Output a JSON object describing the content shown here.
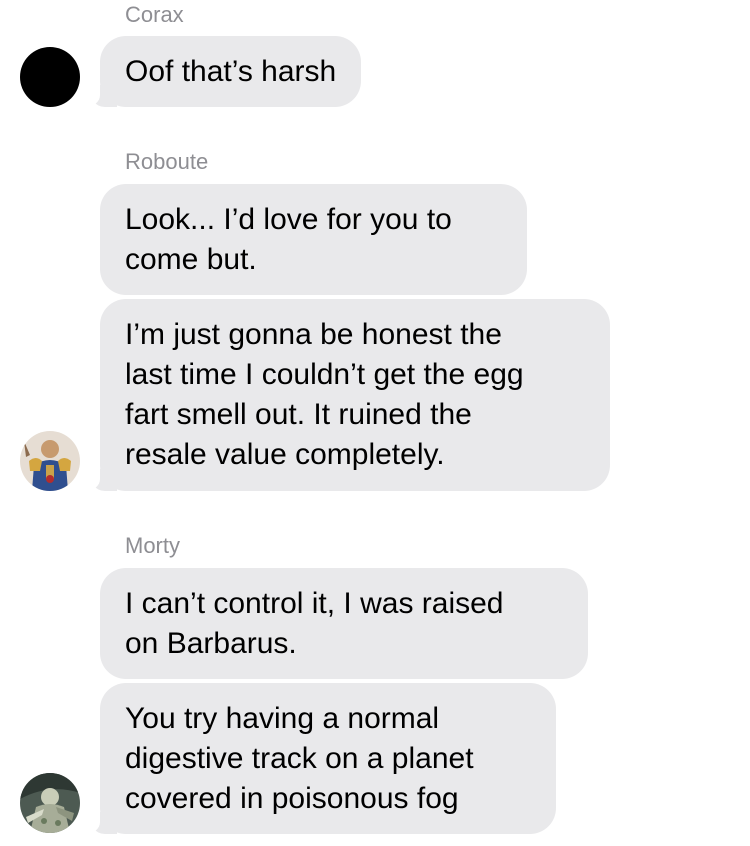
{
  "conversation": [
    {
      "sender": "Corax",
      "avatar": "black-circle-avatar",
      "messages": [
        {
          "lines": [
            "Oof that’s harsh"
          ]
        }
      ]
    },
    {
      "sender": "Roboute",
      "avatar": "armored-figure-avatar",
      "messages": [
        {
          "lines": [
            "Look... I’d love for you to",
            "come but."
          ]
        },
        {
          "lines": [
            "I’m just gonna be honest the",
            "last time I couldn’t get the egg",
            "fart smell out. It ruined the",
            "resale value completely."
          ]
        }
      ]
    },
    {
      "sender": "Morty",
      "avatar": "pale-warrior-avatar",
      "messages": [
        {
          "lines": [
            "I can’t control it, I was raised",
            "on Barbarus."
          ]
        },
        {
          "lines": [
            "You try having a normal",
            "digestive track on a planet",
            "covered in poisonous fog"
          ]
        }
      ]
    }
  ],
  "colors": {
    "bubble": "#e9e9eb",
    "sender_name": "#8e8e93",
    "text": "#000000",
    "background": "#ffffff"
  }
}
